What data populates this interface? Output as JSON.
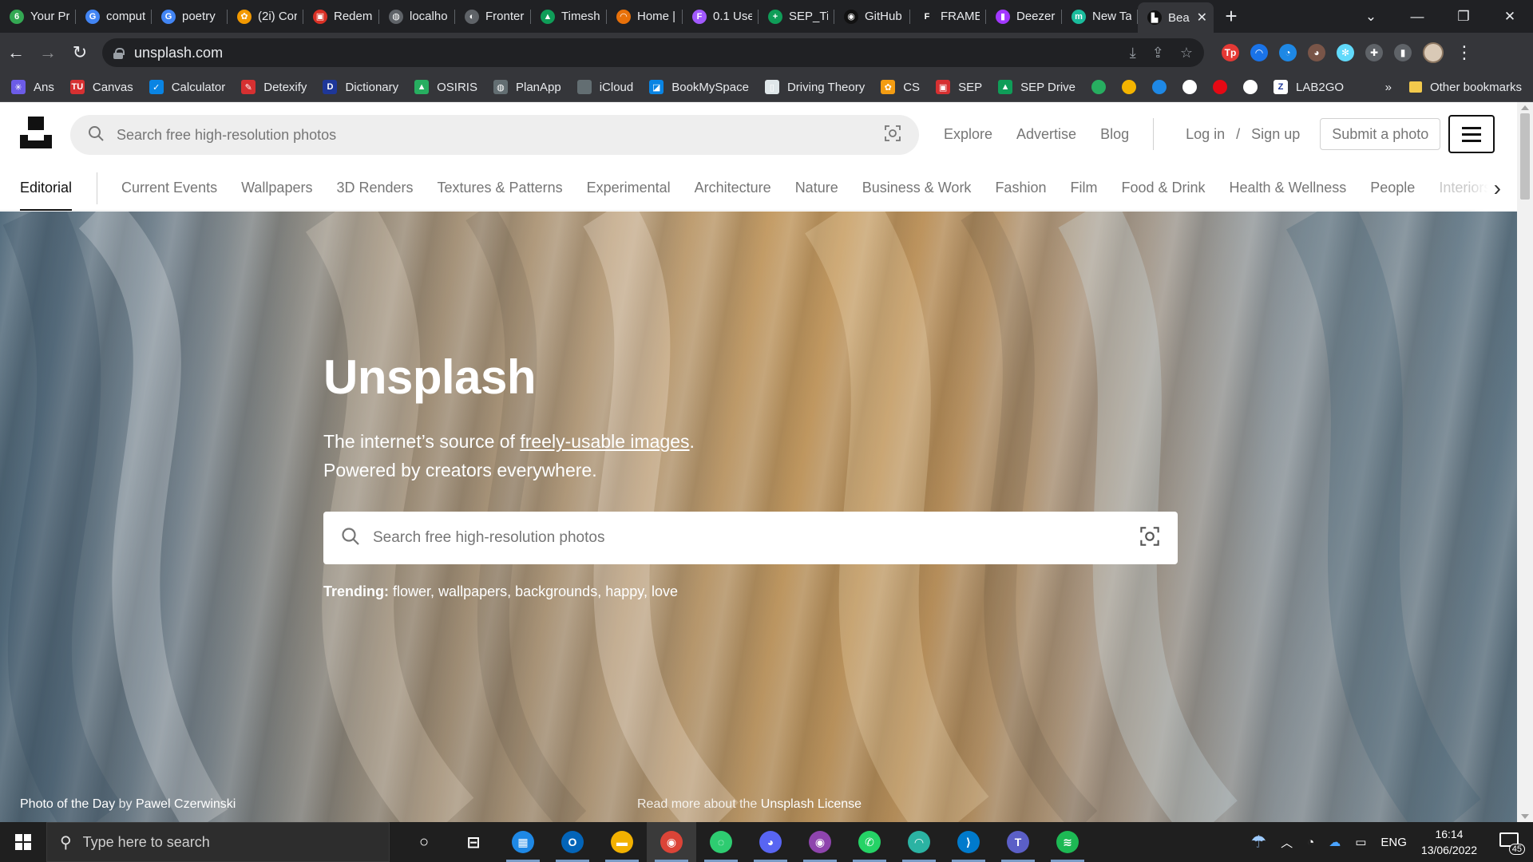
{
  "browser": {
    "tabs": [
      {
        "title": "Your Pr",
        "color": "#34a853",
        "glyph": "6"
      },
      {
        "title": "comput",
        "color": "#4285f4",
        "glyph": "G"
      },
      {
        "title": "poetry",
        "color": "#4285f4",
        "glyph": "G"
      },
      {
        "title": "(2i) Cor",
        "color": "#f29900",
        "glyph": "✿"
      },
      {
        "title": "Redem",
        "color": "#d93025",
        "glyph": "▣"
      },
      {
        "title": "localho",
        "color": "#5f6368",
        "glyph": "◍"
      },
      {
        "title": "Fronter",
        "color": "#5f6368",
        "glyph": "◐"
      },
      {
        "title": "Timesh",
        "color": "#0f9d58",
        "glyph": "▲"
      },
      {
        "title": "Home |",
        "color": "#e8710a",
        "glyph": "◠"
      },
      {
        "title": "0.1 Use",
        "color": "#a259ff",
        "glyph": "F"
      },
      {
        "title": "SEP_Tir",
        "color": "#0f9d58",
        "glyph": "+"
      },
      {
        "title": "GitHub",
        "color": "#111111",
        "glyph": "◉"
      },
      {
        "title": "FRAME",
        "color": "#202124",
        "glyph": "F"
      },
      {
        "title": "Deezer",
        "color": "#a238ff",
        "glyph": "▮"
      },
      {
        "title": "New Ta",
        "color": "#1abc9c",
        "glyph": "m"
      },
      {
        "title": "Bea",
        "color": "#111111",
        "glyph": "▙",
        "active": true
      }
    ],
    "new_tab": "+",
    "window_controls": [
      "⌄",
      "—",
      "❐",
      "✕"
    ],
    "back": "←",
    "forward": "→",
    "reload": "↻",
    "url": "unsplash.com",
    "omnibox_icons": [
      "⤓",
      "⇪",
      "☆"
    ],
    "extensions": [
      {
        "name": "tp-icon",
        "color": "#e53935",
        "glyph": "Tp"
      },
      {
        "name": "arc-icon",
        "color": "#1a73e8",
        "glyph": "◠"
      },
      {
        "name": "translate-icon",
        "color": "#1e88e5",
        "glyph": "◔"
      },
      {
        "name": "owl-icon",
        "color": "#795548",
        "glyph": "◕"
      },
      {
        "name": "react-icon",
        "color": "#61dafb",
        "glyph": "✻"
      },
      {
        "name": "puzzle-icon",
        "color": "#5f6368",
        "glyph": "✚"
      },
      {
        "name": "sidepanel-icon",
        "color": "#5f6368",
        "glyph": "▮"
      }
    ],
    "menu": "⋮"
  },
  "bookmarks": {
    "items": [
      {
        "label": "Ans",
        "color": "#6c5ce7",
        "glyph": "✳"
      },
      {
        "label": "Canvas",
        "color": "#d63031",
        "glyph": "TU"
      },
      {
        "label": "Calculator",
        "color": "#0984e3",
        "glyph": "✓"
      },
      {
        "label": "Detexify",
        "color": "#d63031",
        "glyph": "✎"
      },
      {
        "label": "Dictionary",
        "color": "#1e3799",
        "glyph": "D"
      },
      {
        "label": "OSIRIS",
        "color": "#27ae60",
        "glyph": "▲"
      },
      {
        "label": "PlanApp",
        "color": "#636e72",
        "glyph": "◍"
      },
      {
        "label": "iCloud",
        "color": "#636e72",
        "glyph": ""
      },
      {
        "label": "BookMySpace",
        "color": "#0984e3",
        "glyph": "◪"
      },
      {
        "label": "Driving Theory",
        "color": "#dfe6e9",
        "glyph": "▯"
      },
      {
        "label": "CS",
        "color": "#f39c12",
        "glyph": "✿"
      },
      {
        "label": "SEP",
        "color": "#d63031",
        "glyph": "▣"
      },
      {
        "label": "SEP Drive",
        "color": "#0f9d58",
        "glyph": "▲"
      }
    ],
    "icon_only": [
      {
        "name": "leaf-bookmark-icon",
        "color": "#27ae60"
      },
      {
        "name": "drive-bookmark-icon",
        "color": "#f4b400"
      },
      {
        "name": "m-bookmark-icon",
        "color": "#1e88e5"
      },
      {
        "name": "github-bookmark-icon",
        "color": "#ffffff"
      },
      {
        "name": "netflix-bookmark-icon",
        "color": "#e50914"
      },
      {
        "name": "chrome-bookmark-icon",
        "color": "#ffffff"
      }
    ],
    "lab2go": "LAB2GO",
    "lab2go_glyph": "Z",
    "more": "»",
    "other": "Other bookmarks"
  },
  "site": {
    "header_search_placeholder": "Search free high-resolution photos",
    "nav": [
      "Explore",
      "Advertise",
      "Blog"
    ],
    "login": "Log in",
    "slash": "/",
    "signup": "Sign up",
    "submit": "Submit a photo",
    "topics": [
      "Editorial",
      "Current Events",
      "Wallpapers",
      "3D Renders",
      "Textures & Patterns",
      "Experimental",
      "Architecture",
      "Nature",
      "Business & Work",
      "Fashion",
      "Film",
      "Food & Drink",
      "Health & Wellness",
      "People",
      "Interiors"
    ]
  },
  "hero": {
    "title": "Unsplash",
    "subtitle_prefix": "The internet’s source of ",
    "subtitle_link": "freely-usable images",
    "subtitle_suffix": ".",
    "subtitle_line2": "Powered by creators everywhere.",
    "search_placeholder": "Search free high-resolution photos",
    "trending_label": "Trending:",
    "trending": [
      "flower",
      "wallpapers",
      "backgrounds",
      "happy",
      "love"
    ],
    "photo_of_day_prefix": "Photo of the Day",
    "photo_by": " by ",
    "photographer": "Pawel Czerwinski",
    "license_prefix": "Read more about the ",
    "license_link": "Unsplash License"
  },
  "taskbar": {
    "search_placeholder": "Type here to search",
    "apps": [
      {
        "name": "cortana-icon",
        "glyph": "○",
        "color": "#1f1f1f"
      },
      {
        "name": "task-view-icon",
        "glyph": "⊟",
        "color": "#1f1f1f"
      },
      {
        "name": "calendar-app-icon",
        "glyph": "▦",
        "color": "#1e88e5",
        "running": true
      },
      {
        "name": "outlook-app-icon",
        "glyph": "O",
        "color": "#0364b8",
        "running": true
      },
      {
        "name": "file-explorer-icon",
        "glyph": "▬",
        "color": "#f2b100",
        "running": true
      },
      {
        "name": "chrome-app-icon",
        "glyph": "◉",
        "color": "#db4437",
        "running": true,
        "active": true
      },
      {
        "name": "loader-app-icon",
        "glyph": "◌",
        "color": "#2ecc71",
        "running": true
      },
      {
        "name": "discord-app-icon",
        "glyph": "◕",
        "color": "#5865f2",
        "running": true
      },
      {
        "name": "github-desktop-icon",
        "glyph": "◉",
        "color": "#8e44ad",
        "running": true
      },
      {
        "name": "whatsapp-app-icon",
        "glyph": "✆",
        "color": "#25d366",
        "running": true
      },
      {
        "name": "arc-app-icon",
        "glyph": "◠",
        "color": "#2bb3a3",
        "running": true
      },
      {
        "name": "vscode-app-icon",
        "glyph": "⟩",
        "color": "#007acc",
        "running": true
      },
      {
        "name": "teams-app-icon",
        "glyph": "T",
        "color": "#5b5fc7",
        "running": true
      },
      {
        "name": "spotify-app-icon",
        "glyph": "≋",
        "color": "#1db954",
        "running": true
      }
    ],
    "tray_weather": "☂",
    "tray_chevron": "︿",
    "tray_network": "◔",
    "tray_cloud": "☁",
    "tray_battery": "▭",
    "language": "ENG",
    "time": "16:14",
    "date": "13/06/2022",
    "notifications": "45"
  }
}
